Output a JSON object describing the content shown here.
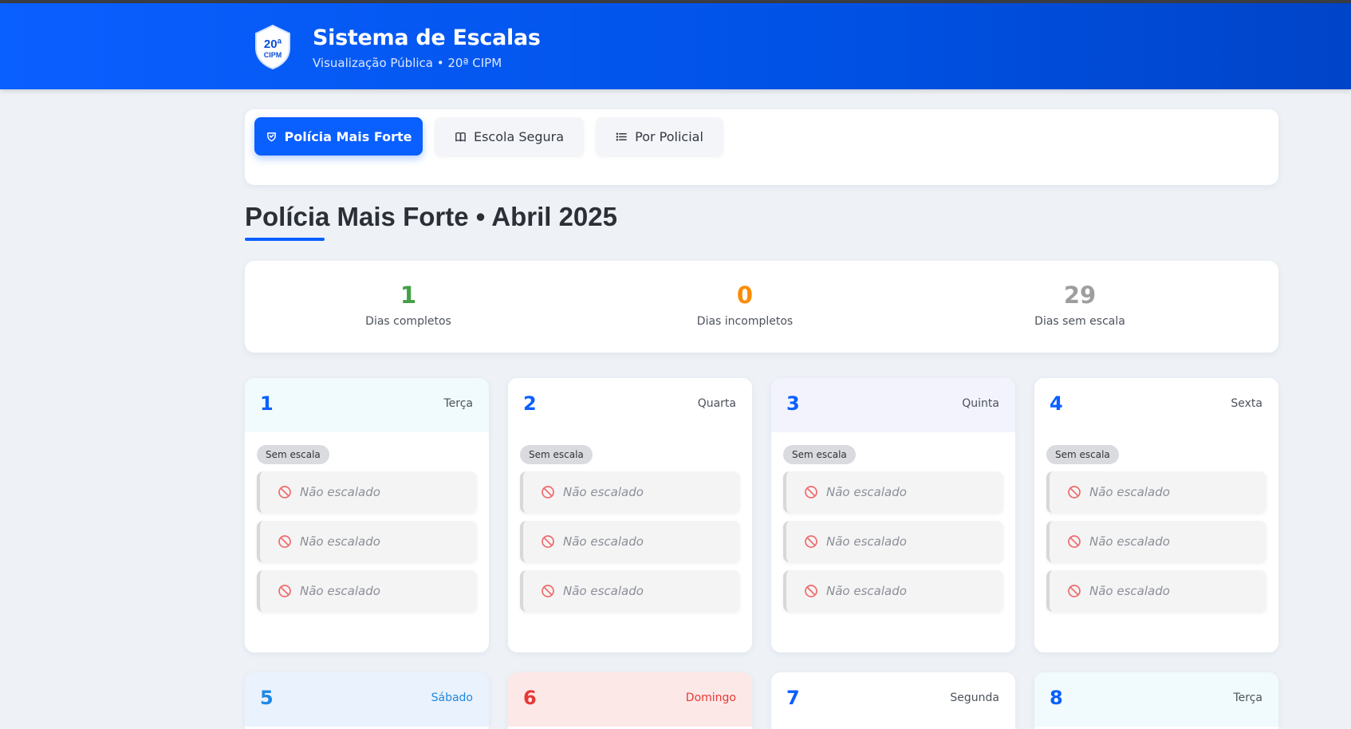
{
  "header": {
    "badge_top": "20ª",
    "badge_bottom": "CIPM",
    "title": "Sistema de Escalas",
    "subtitle": "Visualização Pública • 20ª CIPM"
  },
  "tabs": [
    {
      "label": "Polícia Mais Forte",
      "icon": "badge-icon",
      "active": true
    },
    {
      "label": "Escola Segura",
      "icon": "book-icon",
      "active": false
    },
    {
      "label": "Por Policial",
      "icon": "list-icon",
      "active": false
    }
  ],
  "page_title": "Polícia Mais Forte • Abril 2025",
  "stats": [
    {
      "value": "1",
      "label": "Dias completos",
      "color": "#43a047"
    },
    {
      "value": "0",
      "label": "Dias incompletos",
      "color": "#fb8c00"
    },
    {
      "value": "29",
      "label": "Dias sem escala",
      "color": "#9e9e9e"
    }
  ],
  "days": [
    {
      "num": "1",
      "weekday": "Terça",
      "badge": "Sem escala",
      "slots": [
        "Não escalado",
        "Não escalado",
        "Não escalado"
      ]
    },
    {
      "num": "2",
      "weekday": "Quarta",
      "badge": "Sem escala",
      "slots": [
        "Não escalado",
        "Não escalado",
        "Não escalado"
      ]
    },
    {
      "num": "3",
      "weekday": "Quinta",
      "badge": "Sem escala",
      "slots": [
        "Não escalado",
        "Não escalado",
        "Não escalado"
      ]
    },
    {
      "num": "4",
      "weekday": "Sexta",
      "badge": "Sem escala",
      "slots": [
        "Não escalado",
        "Não escalado",
        "Não escalado"
      ]
    },
    {
      "num": "5",
      "weekday": "Sábado"
    },
    {
      "num": "6",
      "weekday": "Domingo"
    },
    {
      "num": "7",
      "weekday": "Segunda"
    },
    {
      "num": "8",
      "weekday": "Terça"
    }
  ],
  "colors": {
    "primary": "#0a5fff",
    "weekend_sunday": "#e53935",
    "slot_icon": "#ef6b6b"
  }
}
